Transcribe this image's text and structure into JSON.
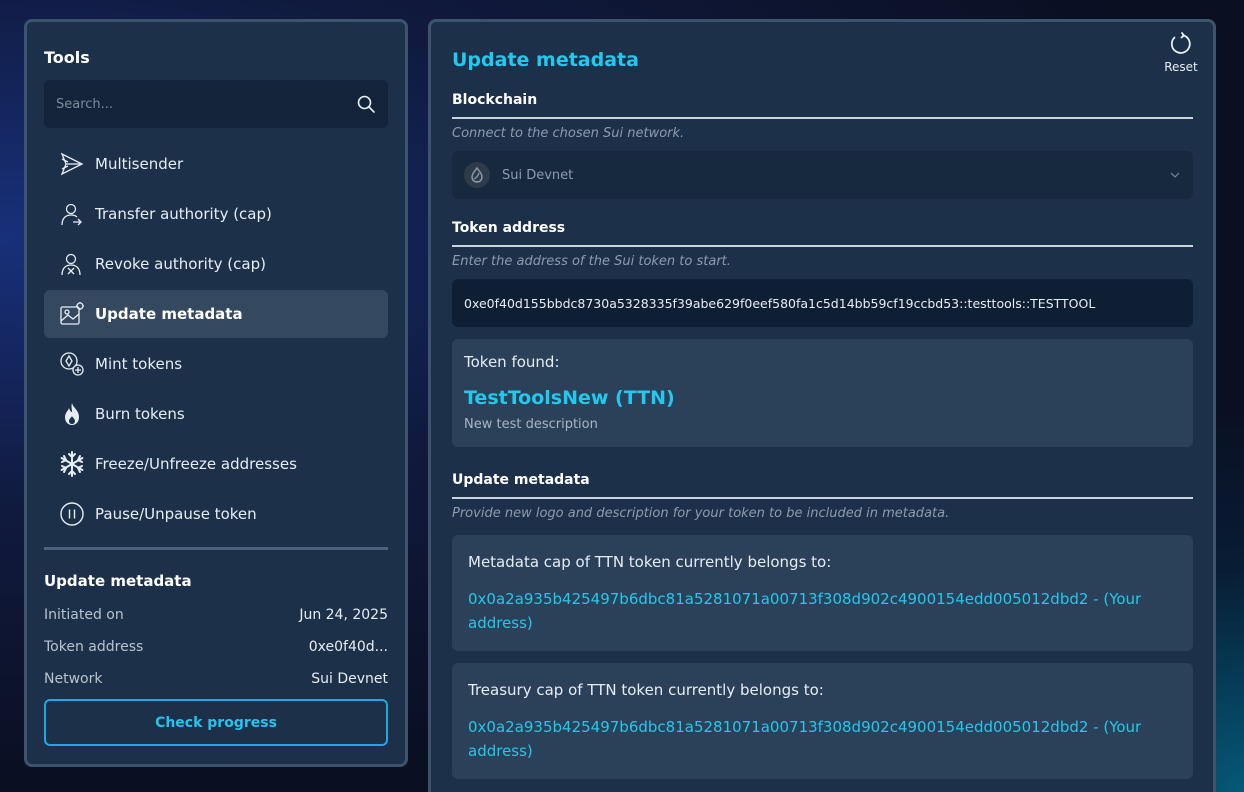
{
  "sidebar": {
    "title": "Tools",
    "search_placeholder": "Search...",
    "items": [
      {
        "label": "Multisender",
        "icon": "send-icon",
        "active": false
      },
      {
        "label": "Transfer authority (cap)",
        "icon": "user-transfer-icon",
        "active": false
      },
      {
        "label": "Revoke authority (cap)",
        "icon": "user-revoke-icon",
        "active": false
      },
      {
        "label": "Update metadata",
        "icon": "image-edit-icon",
        "active": true
      },
      {
        "label": "Mint tokens",
        "icon": "coin-add-icon",
        "active": false
      },
      {
        "label": "Burn tokens",
        "icon": "flame-icon",
        "active": false
      },
      {
        "label": "Freeze/Unfreeze addresses",
        "icon": "snowflake-icon",
        "active": false
      },
      {
        "label": "Pause/Unpause token",
        "icon": "pause-icon",
        "active": false
      }
    ],
    "summary": {
      "title": "Update metadata",
      "rows": [
        {
          "key": "Initiated on",
          "value": "Jun 24, 2025"
        },
        {
          "key": "Token address",
          "value": "0xe0f40d..."
        },
        {
          "key": "Network",
          "value": "Sui Devnet"
        }
      ],
      "button": "Check progress"
    }
  },
  "main": {
    "title": "Update metadata",
    "reset_label": "Reset",
    "blockchain": {
      "heading": "Blockchain",
      "hint": "Connect to the chosen Sui network.",
      "selected": "Sui Devnet"
    },
    "token_address": {
      "heading": "Token address",
      "hint": "Enter the address of the Sui token to start.",
      "value": "0xe0f40d155bbdc8730a5328335f39abe629f0eef580fa1c5d14bb59cf19ccbd53::testtools::TESTTOOL"
    },
    "token_found": {
      "label": "Token found:",
      "name": "TestToolsNew (TTN)",
      "description": "New test description"
    },
    "update_metadata": {
      "heading": "Update metadata",
      "hint": "Provide new logo and description for your token to be included in metadata.",
      "metadata_cap_label": "Metadata cap of TTN token currently belongs to:",
      "metadata_cap_value": "0x0a2a935b425497b6dbc81a5281071a00713f308d902c4900154edd005012dbd2 - (Your address)",
      "treasury_cap_label": "Treasury cap of TTN token currently belongs to:",
      "treasury_cap_value": "0x0a2a935b425497b6dbc81a5281071a00713f308d902c4900154edd005012dbd2 - (Your address)"
    }
  },
  "colors": {
    "accent": "#22c9ee",
    "panel": "#1d3049",
    "panel_border": "#3c536e",
    "card": "#2b4059"
  }
}
